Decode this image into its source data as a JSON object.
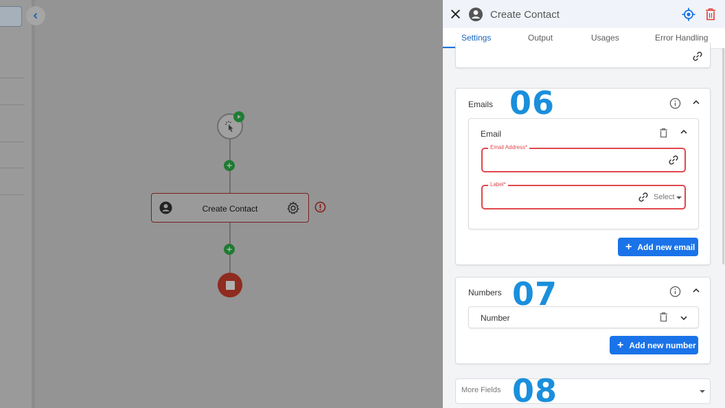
{
  "canvas": {
    "action_node": {
      "label": "Create Contact"
    }
  },
  "panel": {
    "title": "Create Contact",
    "tabs": [
      {
        "label": "Settings",
        "active": true
      },
      {
        "label": "Output",
        "active": false
      },
      {
        "label": "Usages",
        "active": false
      },
      {
        "label": "Error Handling",
        "active": false
      }
    ],
    "emails_section": {
      "label": "Emails",
      "annotation": "06",
      "item": {
        "label": "Email",
        "email_address_label": "Email Address*",
        "label_field_label": "Label*",
        "select_text": "Select"
      },
      "add_button": "Add new email"
    },
    "numbers_section": {
      "label": "Numbers",
      "annotation": "07",
      "item": {
        "label": "Number"
      },
      "add_button": "Add new number"
    },
    "more_fields": {
      "label": "More Fields",
      "annotation": "08"
    }
  },
  "colors": {
    "accent": "#1a73e8",
    "error": "#e0474c",
    "annotation": "#1a8fdc",
    "success": "#1f7a33",
    "stop": "#8f2b1f"
  }
}
